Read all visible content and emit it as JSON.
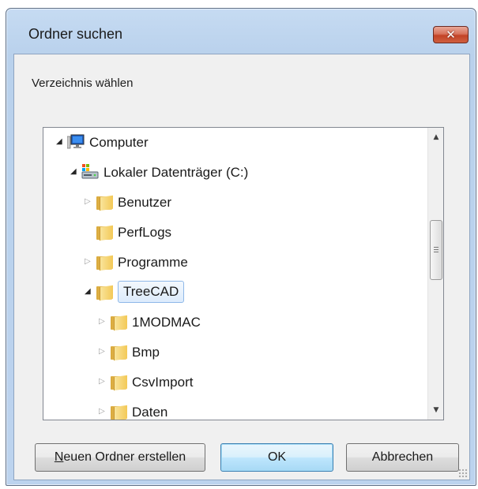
{
  "window": {
    "title": "Ordner suchen",
    "close_glyph": "✕"
  },
  "description": "Verzeichnis wählen",
  "tree": {
    "items": [
      {
        "label": "Computer",
        "level": 0,
        "toggle": "open",
        "icon": "computer-icon"
      },
      {
        "label": "Lokaler Datenträger (C:)",
        "level": 1,
        "toggle": "open",
        "icon": "hard-drive-icon"
      },
      {
        "label": "Benutzer",
        "level": 2,
        "toggle": "closed",
        "icon": "folder-icon"
      },
      {
        "label": "PerfLogs",
        "level": 2,
        "toggle": "none",
        "icon": "folder-icon"
      },
      {
        "label": "Programme",
        "level": 2,
        "toggle": "closed",
        "icon": "folder-icon"
      },
      {
        "label": "TreeCAD",
        "level": 2,
        "toggle": "open",
        "icon": "folder-icon",
        "selected": true
      },
      {
        "label": "1MODMAC",
        "level": 3,
        "toggle": "closed",
        "icon": "folder-icon"
      },
      {
        "label": "Bmp",
        "level": 3,
        "toggle": "closed",
        "icon": "folder-icon"
      },
      {
        "label": "CsvImport",
        "level": 3,
        "toggle": "closed",
        "icon": "folder-icon"
      },
      {
        "label": "Daten",
        "level": 3,
        "toggle": "closed",
        "icon": "folder-icon"
      }
    ],
    "scroll_up_glyph": "▲",
    "scroll_down_glyph": "▼"
  },
  "buttons": {
    "new_folder_mnemonic": "N",
    "new_folder_rest": "euen Ordner erstellen",
    "ok": "OK",
    "cancel": "Abbrechen"
  },
  "colors": {
    "title_bar": "#bcd3ee",
    "close_button": "#c94a2e",
    "selection_border": "#8fb8e8",
    "default_button": "#bee6fd"
  }
}
